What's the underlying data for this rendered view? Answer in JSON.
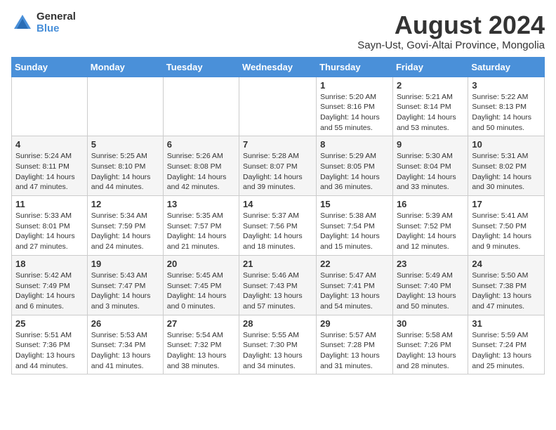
{
  "logo": {
    "general": "General",
    "blue": "Blue"
  },
  "title": {
    "month_year": "August 2024",
    "location": "Sayn-Ust, Govi-Altai Province, Mongolia"
  },
  "headers": [
    "Sunday",
    "Monday",
    "Tuesday",
    "Wednesday",
    "Thursday",
    "Friday",
    "Saturday"
  ],
  "weeks": [
    [
      {
        "day": "",
        "sunrise": "",
        "sunset": "",
        "daylight": ""
      },
      {
        "day": "",
        "sunrise": "",
        "sunset": "",
        "daylight": ""
      },
      {
        "day": "",
        "sunrise": "",
        "sunset": "",
        "daylight": ""
      },
      {
        "day": "",
        "sunrise": "",
        "sunset": "",
        "daylight": ""
      },
      {
        "day": "1",
        "sunrise": "Sunrise: 5:20 AM",
        "sunset": "Sunset: 8:16 PM",
        "daylight": "Daylight: 14 hours and 55 minutes."
      },
      {
        "day": "2",
        "sunrise": "Sunrise: 5:21 AM",
        "sunset": "Sunset: 8:14 PM",
        "daylight": "Daylight: 14 hours and 53 minutes."
      },
      {
        "day": "3",
        "sunrise": "Sunrise: 5:22 AM",
        "sunset": "Sunset: 8:13 PM",
        "daylight": "Daylight: 14 hours and 50 minutes."
      }
    ],
    [
      {
        "day": "4",
        "sunrise": "Sunrise: 5:24 AM",
        "sunset": "Sunset: 8:11 PM",
        "daylight": "Daylight: 14 hours and 47 minutes."
      },
      {
        "day": "5",
        "sunrise": "Sunrise: 5:25 AM",
        "sunset": "Sunset: 8:10 PM",
        "daylight": "Daylight: 14 hours and 44 minutes."
      },
      {
        "day": "6",
        "sunrise": "Sunrise: 5:26 AM",
        "sunset": "Sunset: 8:08 PM",
        "daylight": "Daylight: 14 hours and 42 minutes."
      },
      {
        "day": "7",
        "sunrise": "Sunrise: 5:28 AM",
        "sunset": "Sunset: 8:07 PM",
        "daylight": "Daylight: 14 hours and 39 minutes."
      },
      {
        "day": "8",
        "sunrise": "Sunrise: 5:29 AM",
        "sunset": "Sunset: 8:05 PM",
        "daylight": "Daylight: 14 hours and 36 minutes."
      },
      {
        "day": "9",
        "sunrise": "Sunrise: 5:30 AM",
        "sunset": "Sunset: 8:04 PM",
        "daylight": "Daylight: 14 hours and 33 minutes."
      },
      {
        "day": "10",
        "sunrise": "Sunrise: 5:31 AM",
        "sunset": "Sunset: 8:02 PM",
        "daylight": "Daylight: 14 hours and 30 minutes."
      }
    ],
    [
      {
        "day": "11",
        "sunrise": "Sunrise: 5:33 AM",
        "sunset": "Sunset: 8:01 PM",
        "daylight": "Daylight: 14 hours and 27 minutes."
      },
      {
        "day": "12",
        "sunrise": "Sunrise: 5:34 AM",
        "sunset": "Sunset: 7:59 PM",
        "daylight": "Daylight: 14 hours and 24 minutes."
      },
      {
        "day": "13",
        "sunrise": "Sunrise: 5:35 AM",
        "sunset": "Sunset: 7:57 PM",
        "daylight": "Daylight: 14 hours and 21 minutes."
      },
      {
        "day": "14",
        "sunrise": "Sunrise: 5:37 AM",
        "sunset": "Sunset: 7:56 PM",
        "daylight": "Daylight: 14 hours and 18 minutes."
      },
      {
        "day": "15",
        "sunrise": "Sunrise: 5:38 AM",
        "sunset": "Sunset: 7:54 PM",
        "daylight": "Daylight: 14 hours and 15 minutes."
      },
      {
        "day": "16",
        "sunrise": "Sunrise: 5:39 AM",
        "sunset": "Sunset: 7:52 PM",
        "daylight": "Daylight: 14 hours and 12 minutes."
      },
      {
        "day": "17",
        "sunrise": "Sunrise: 5:41 AM",
        "sunset": "Sunset: 7:50 PM",
        "daylight": "Daylight: 14 hours and 9 minutes."
      }
    ],
    [
      {
        "day": "18",
        "sunrise": "Sunrise: 5:42 AM",
        "sunset": "Sunset: 7:49 PM",
        "daylight": "Daylight: 14 hours and 6 minutes."
      },
      {
        "day": "19",
        "sunrise": "Sunrise: 5:43 AM",
        "sunset": "Sunset: 7:47 PM",
        "daylight": "Daylight: 14 hours and 3 minutes."
      },
      {
        "day": "20",
        "sunrise": "Sunrise: 5:45 AM",
        "sunset": "Sunset: 7:45 PM",
        "daylight": "Daylight: 14 hours and 0 minutes."
      },
      {
        "day": "21",
        "sunrise": "Sunrise: 5:46 AM",
        "sunset": "Sunset: 7:43 PM",
        "daylight": "Daylight: 13 hours and 57 minutes."
      },
      {
        "day": "22",
        "sunrise": "Sunrise: 5:47 AM",
        "sunset": "Sunset: 7:41 PM",
        "daylight": "Daylight: 13 hours and 54 minutes."
      },
      {
        "day": "23",
        "sunrise": "Sunrise: 5:49 AM",
        "sunset": "Sunset: 7:40 PM",
        "daylight": "Daylight: 13 hours and 50 minutes."
      },
      {
        "day": "24",
        "sunrise": "Sunrise: 5:50 AM",
        "sunset": "Sunset: 7:38 PM",
        "daylight": "Daylight: 13 hours and 47 minutes."
      }
    ],
    [
      {
        "day": "25",
        "sunrise": "Sunrise: 5:51 AM",
        "sunset": "Sunset: 7:36 PM",
        "daylight": "Daylight: 13 hours and 44 minutes."
      },
      {
        "day": "26",
        "sunrise": "Sunrise: 5:53 AM",
        "sunset": "Sunset: 7:34 PM",
        "daylight": "Daylight: 13 hours and 41 minutes."
      },
      {
        "day": "27",
        "sunrise": "Sunrise: 5:54 AM",
        "sunset": "Sunset: 7:32 PM",
        "daylight": "Daylight: 13 hours and 38 minutes."
      },
      {
        "day": "28",
        "sunrise": "Sunrise: 5:55 AM",
        "sunset": "Sunset: 7:30 PM",
        "daylight": "Daylight: 13 hours and 34 minutes."
      },
      {
        "day": "29",
        "sunrise": "Sunrise: 5:57 AM",
        "sunset": "Sunset: 7:28 PM",
        "daylight": "Daylight: 13 hours and 31 minutes."
      },
      {
        "day": "30",
        "sunrise": "Sunrise: 5:58 AM",
        "sunset": "Sunset: 7:26 PM",
        "daylight": "Daylight: 13 hours and 28 minutes."
      },
      {
        "day": "31",
        "sunrise": "Sunrise: 5:59 AM",
        "sunset": "Sunset: 7:24 PM",
        "daylight": "Daylight: 13 hours and 25 minutes."
      }
    ]
  ]
}
